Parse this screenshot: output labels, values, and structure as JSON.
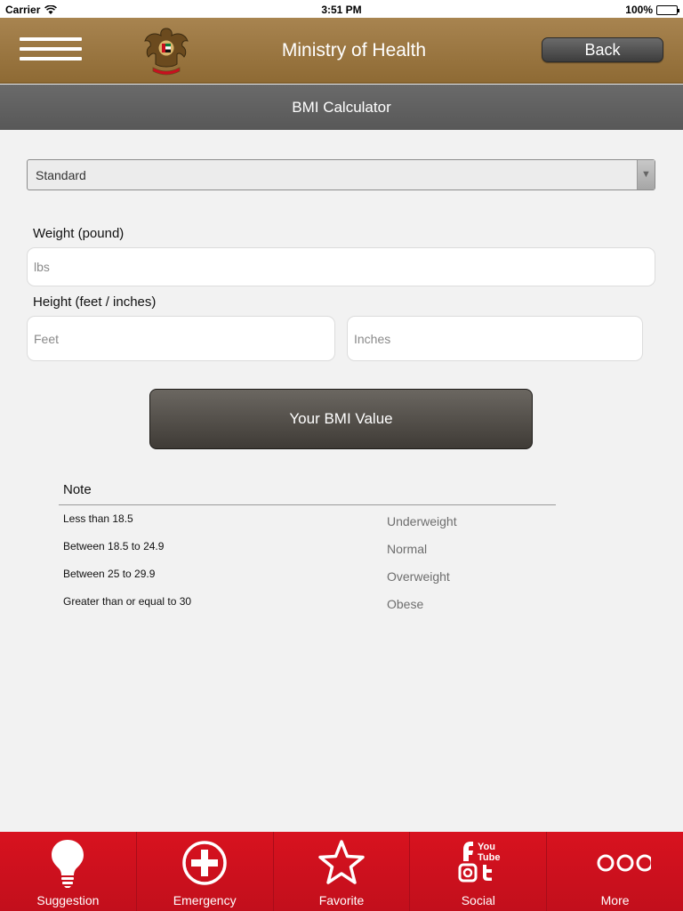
{
  "status_bar": {
    "carrier": "Carrier",
    "time": "3:51 PM",
    "battery": "100%"
  },
  "header": {
    "title": "Ministry of Health",
    "back_label": "Back"
  },
  "subheader": {
    "title": "BMI Calculator"
  },
  "unit_select": {
    "value": "Standard"
  },
  "weight": {
    "label": "Weight (pound)",
    "placeholder": "lbs"
  },
  "height": {
    "label": "Height (feet / inches)",
    "feet_placeholder": "Feet",
    "inches_placeholder": "Inches"
  },
  "bmi_button": {
    "label": "Your BMI Value"
  },
  "note": {
    "title": "Note",
    "rows": [
      {
        "range": "Less than 18.5",
        "category": "Underweight"
      },
      {
        "range": "Between 18.5 to 24.9",
        "category": "Normal"
      },
      {
        "range": "Between 25 to 29.9",
        "category": "Overweight"
      },
      {
        "range": "Greater than or equal to 30",
        "category": "Obese"
      }
    ]
  },
  "tabbar": {
    "items": [
      {
        "label": "Suggestion",
        "icon": "lightbulb-icon"
      },
      {
        "label": "Emergency",
        "icon": "plus-circle-icon"
      },
      {
        "label": "Favorite",
        "icon": "star-icon"
      },
      {
        "label": "Social",
        "icon": "social-icon"
      },
      {
        "label": "More",
        "icon": "more-icon"
      }
    ]
  },
  "colors": {
    "header": "#9a7640",
    "subheader": "#616161",
    "tabbar": "#c8101f",
    "button": "#514d48"
  }
}
